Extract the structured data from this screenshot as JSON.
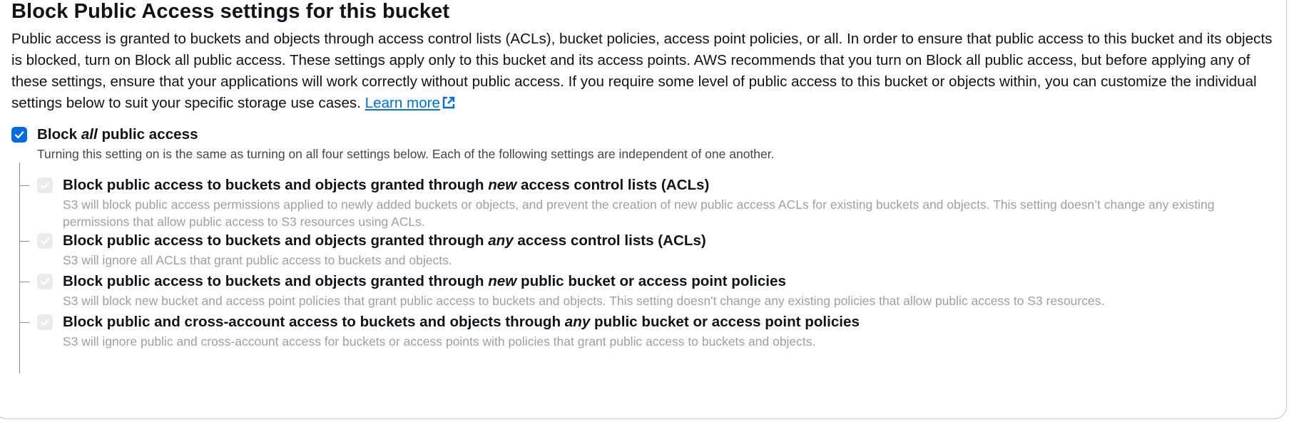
{
  "section": {
    "title": "Block Public Access settings for this bucket",
    "description": "Public access is granted to buckets and objects through access control lists (ACLs), bucket policies, access point policies, or all. In order to ensure that public access to this bucket and its objects is blocked, turn on Block all public access. These settings apply only to this bucket and its access points. AWS recommends that you turn on Block all public access, but before applying any of these settings, ensure that your applications will work correctly without public access. If you require some level of public access to this bucket or objects within, you can customize the individual settings below to suit your specific storage use cases.",
    "learn_more": "Learn more",
    "link_icon": "external-link-icon"
  },
  "block_all": {
    "label_prefix": "Block ",
    "label_em": "all",
    "label_suffix": " public access",
    "checked": true,
    "description": "Turning this setting on is the same as turning on all four settings below. Each of the following settings are independent of one another."
  },
  "settings": [
    {
      "label_prefix": "Block public access to buckets and objects granted through ",
      "label_em": "new",
      "label_suffix": " access control lists (ACLs)",
      "checked": true,
      "disabled": true,
      "description": "S3 will block public access permissions applied to newly added buckets or objects, and prevent the creation of new public access ACLs for existing buckets and objects. This setting doesn’t change any existing permissions that allow public access to S3 resources using ACLs."
    },
    {
      "label_prefix": "Block public access to buckets and objects granted through ",
      "label_em": "any",
      "label_suffix": " access control lists (ACLs)",
      "checked": true,
      "disabled": true,
      "description": "S3 will ignore all ACLs that grant public access to buckets and objects."
    },
    {
      "label_prefix": "Block public access to buckets and objects granted through ",
      "label_em": "new",
      "label_suffix": " public bucket or access point policies",
      "checked": true,
      "disabled": true,
      "description": "S3 will block new bucket and access point policies that grant public access to buckets and objects. This setting doesn't change any existing policies that allow public access to S3 resources."
    },
    {
      "label_prefix": "Block public and cross-account access to buckets and objects through ",
      "label_em": "any",
      "label_suffix": " public bucket or access point policies",
      "checked": true,
      "disabled": true,
      "description": "S3 will ignore public and cross-account access for buckets or access points with policies that grant public access to buckets and objects."
    }
  ],
  "colors": {
    "accent": "#006ce0",
    "disabled_checkbox": "#e9ebed",
    "disabled_text": "#9ba0a8"
  }
}
